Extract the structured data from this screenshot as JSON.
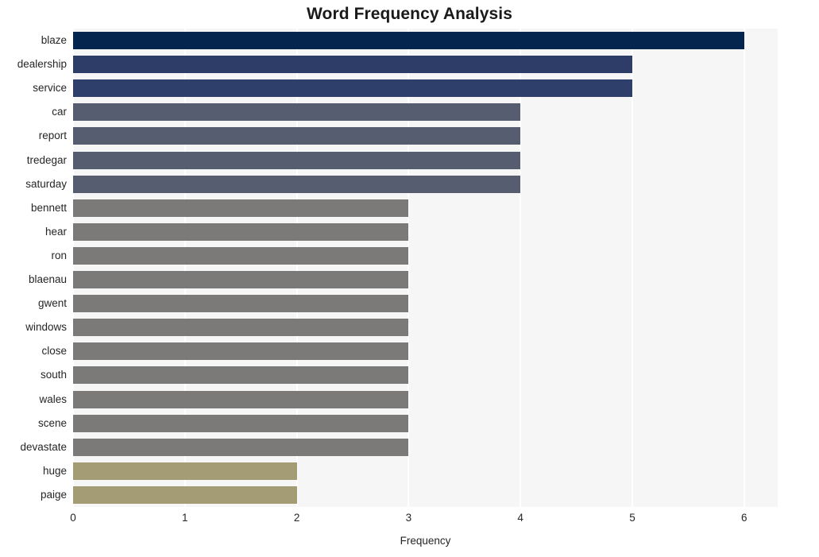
{
  "chart_data": {
    "type": "bar",
    "orientation": "horizontal",
    "title": "Word Frequency Analysis",
    "xlabel": "Frequency",
    "ylabel": "",
    "xlim": [
      0,
      6.3
    ],
    "xticks": [
      "0",
      "1",
      "2",
      "3",
      "4",
      "5",
      "6"
    ],
    "xtick_values": [
      0,
      1,
      2,
      3,
      4,
      5,
      6
    ],
    "grid": "vertical-only",
    "legend": "none",
    "categories": [
      "blaze",
      "dealership",
      "service",
      "car",
      "report",
      "tredegar",
      "saturday",
      "bennett",
      "hear",
      "ron",
      "blaenau",
      "gwent",
      "windows",
      "close",
      "south",
      "wales",
      "scene",
      "devastate",
      "huge",
      "paige"
    ],
    "values": [
      6,
      5,
      5,
      4,
      4,
      4,
      4,
      3,
      3,
      3,
      3,
      3,
      3,
      3,
      3,
      3,
      3,
      3,
      2,
      2
    ],
    "bar_colors": [
      "#04254e",
      "#2e3c68",
      "#2e3f6b",
      "#575d70",
      "#575d70",
      "#575d70",
      "#575d70",
      "#7b7a78",
      "#7b7a78",
      "#7b7a78",
      "#7b7a78",
      "#7b7a78",
      "#7b7a78",
      "#7b7a78",
      "#7b7a78",
      "#7b7a78",
      "#7b7a78",
      "#7b7a78",
      "#a39c74",
      "#a39c74"
    ],
    "plot_background": "#f6f6f7",
    "gridline_color": "#ffffff",
    "figure_background": "#ffffff",
    "text_color": "#262626"
  }
}
